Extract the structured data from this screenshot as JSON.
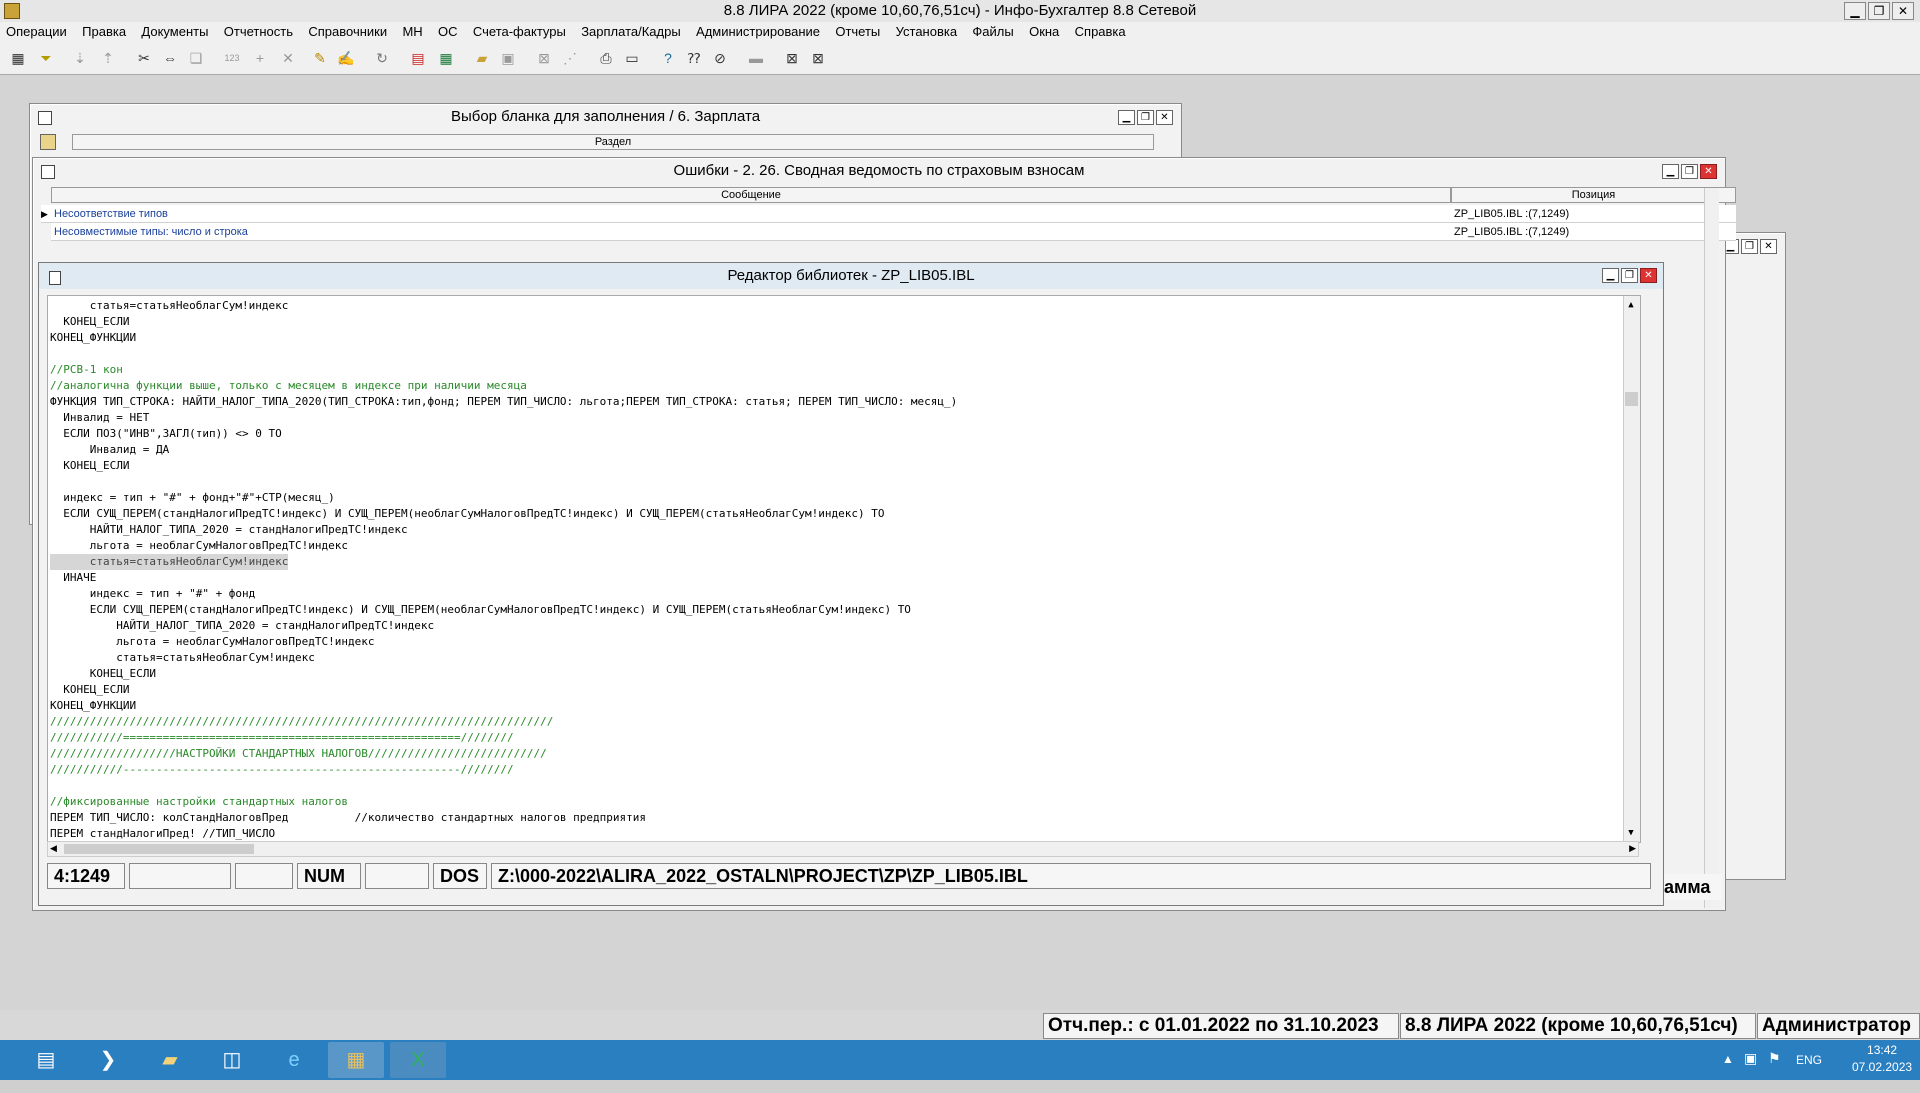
{
  "app": {
    "title": "8.8 ЛИРА 2022 (кроме 10,60,76,51сч) - Инфо-Бухгалтер 8.8 Сетевой",
    "window_buttons": [
      "▁",
      "❐",
      "✕"
    ]
  },
  "menu": [
    "Операции",
    "Правка",
    "Документы",
    "Отчетность",
    "Справочники",
    "МН",
    "ОС",
    "Счета-фактуры",
    "Зарплата/Кадры",
    "Администрирование",
    "Отчеты",
    "Установка",
    "Файлы",
    "Окна",
    "Справка"
  ],
  "toolbar_icons": [
    "calc-icon",
    "filter-icon",
    "sort-asc-icon",
    "sort-desc-icon",
    "cut-icon",
    "resize-icon",
    "copy-icon",
    "numbering-icon",
    "add-icon",
    "delete-icon",
    "marker-icon",
    "replace-icon",
    "refresh-icon",
    "pdf-icon",
    "excel-icon",
    "open-folder-icon",
    "save-icon",
    "export-icon",
    "import-icon",
    "print-icon",
    "preview-icon",
    "help-icon",
    "context-help-icon",
    "compass-icon",
    "hide-icon",
    "close-window-icon",
    "close-all-icon"
  ],
  "win_blank": {
    "title": "Выбор бланка для заполнения /      6. Зарплата",
    "column_header": "Раздел"
  },
  "win_errors": {
    "title": "Ошибки - 2. 26. Сводная ведомость по страховым взносам",
    "columns": [
      "Сообщение",
      "Позиция"
    ],
    "rows": [
      {
        "message": "Несоответствие типов",
        "position": "ZP_LIB05.IBL :(7,1249)"
      },
      {
        "message": "Несовместимые типы: число и строка",
        "position": "ZP_LIB05.IBL :(7,1249)"
      }
    ]
  },
  "editor": {
    "title": "Редактор библиотек - ZP_LIB05.IBL",
    "lines": [
      {
        "text": "      статья=статьяНеоблагСум!индекс",
        "type": "code"
      },
      {
        "text": "  КОНЕЦ_ЕСЛИ",
        "type": "code"
      },
      {
        "text": "КОНЕЦ_ФУНКЦИИ",
        "type": "code"
      },
      {
        "text": "",
        "type": "code"
      },
      {
        "text": "//РСВ-1 кон",
        "type": "comment"
      },
      {
        "text": "//аналогична функции выше, только с месяцем в индексе при наличии месяца",
        "type": "comment"
      },
      {
        "text": "ФУНКЦИЯ ТИП_СТРОКА: НАЙТИ_НАЛОГ_ТИПА_2020(ТИП_СТРОКА:тип,фонд; ПЕРЕМ ТИП_ЧИСЛО: льгота;ПЕРЕМ ТИП_СТРОКА: статья; ПЕРЕМ ТИП_ЧИСЛО: месяц_)",
        "type": "code"
      },
      {
        "text": "  Инвалид = НЕТ",
        "type": "code"
      },
      {
        "text": "  ЕСЛИ ПОЗ(\"ИНВ\",ЗАГЛ(тип)) <> 0 ТО",
        "type": "code"
      },
      {
        "text": "      Инвалид = ДА",
        "type": "code"
      },
      {
        "text": "  КОНЕЦ_ЕСЛИ",
        "type": "code"
      },
      {
        "text": "",
        "type": "code"
      },
      {
        "text": "  индекс = тип + \"#\" + фонд+\"#\"+СТР(месяц_)",
        "type": "code"
      },
      {
        "text": "  ЕСЛИ СУЩ_ПЕРЕМ(стандНалогиПредТС!индекс) И СУЩ_ПЕРЕМ(необлагСумНалоговПредТС!индекс) И СУЩ_ПЕРЕМ(статьяНеоблагСум!индекс) ТО",
        "type": "code"
      },
      {
        "text": "      НАЙТИ_НАЛОГ_ТИПА_2020 = стандНалогиПредТС!индекс",
        "type": "code"
      },
      {
        "text": "      льгота = необлагСумНалоговПредТС!индекс",
        "type": "code"
      },
      {
        "text": "      статья=статьяНеоблагСум!индекс",
        "type": "selected"
      },
      {
        "text": "  ИНАЧЕ",
        "type": "code"
      },
      {
        "text": "      индекс = тип + \"#\" + фонд",
        "type": "code"
      },
      {
        "text": "      ЕСЛИ СУЩ_ПЕРЕМ(стандНалогиПредТС!индекс) И СУЩ_ПЕРЕМ(необлагСумНалоговПредТС!индекс) И СУЩ_ПЕРЕМ(статьяНеоблагСум!индекс) ТО",
        "type": "code"
      },
      {
        "text": "          НАЙТИ_НАЛОГ_ТИПА_2020 = стандНалогиПредТС!индекс",
        "type": "code"
      },
      {
        "text": "          льгота = необлагСумНалоговПредТС!индекс",
        "type": "code"
      },
      {
        "text": "          статья=статьяНеоблагСум!индекс",
        "type": "code"
      },
      {
        "text": "      КОНЕЦ_ЕСЛИ",
        "type": "code"
      },
      {
        "text": "  КОНЕЦ_ЕСЛИ",
        "type": "code"
      },
      {
        "text": "КОНЕЦ_ФУНКЦИИ",
        "type": "code"
      },
      {
        "text": "////////////////////////////////////////////////////////////////////////////",
        "type": "comment"
      },
      {
        "text": "///////////===================================================////////",
        "type": "comment"
      },
      {
        "text": "///////////////////НАСТРОЙКИ СТАНДАРТНЫХ НАЛОГОВ///////////////////////////",
        "type": "comment"
      },
      {
        "text": "///////////---------------------------------------------------////////",
        "type": "comment"
      },
      {
        "text": "",
        "type": "code"
      },
      {
        "text": "//фиксированные настройки стандартных налогов",
        "type": "comment"
      },
      {
        "text": "ПЕРЕМ ТИП_ЧИСЛО: колСтандНалоговПред          //количество стандартных налогов предприятия",
        "type": "code"
      },
      {
        "text": "ПЕРЕМ стандНалогиПред! //ТИП_ЧИСЛО",
        "type": "code"
      }
    ],
    "status": {
      "cursor": "4:1249",
      "num": "NUM",
      "encoding": "DOS",
      "path": "Z:\\000-2022\\ALIRA_2022_OSTALN\\PROJECT\\ZP\\ZP_LIB05.IBL"
    }
  },
  "back_window_fragment": "амма",
  "app_status": {
    "period": "Отч.пер.: с 01.01.2022 по 31.10.2023",
    "org": "8.8 ЛИРА 2022 (кроме 10,60,76,51сч)",
    "user": "Администратор"
  },
  "taskbar": {
    "apps": [
      "server-manager-icon",
      "powershell-icon",
      "explorer-icon",
      "performance-icon",
      "ie-icon",
      "infobuh-icon",
      "excel-icon"
    ],
    "lang": "ENG",
    "time": "13:42",
    "date": "07.02.2023"
  }
}
